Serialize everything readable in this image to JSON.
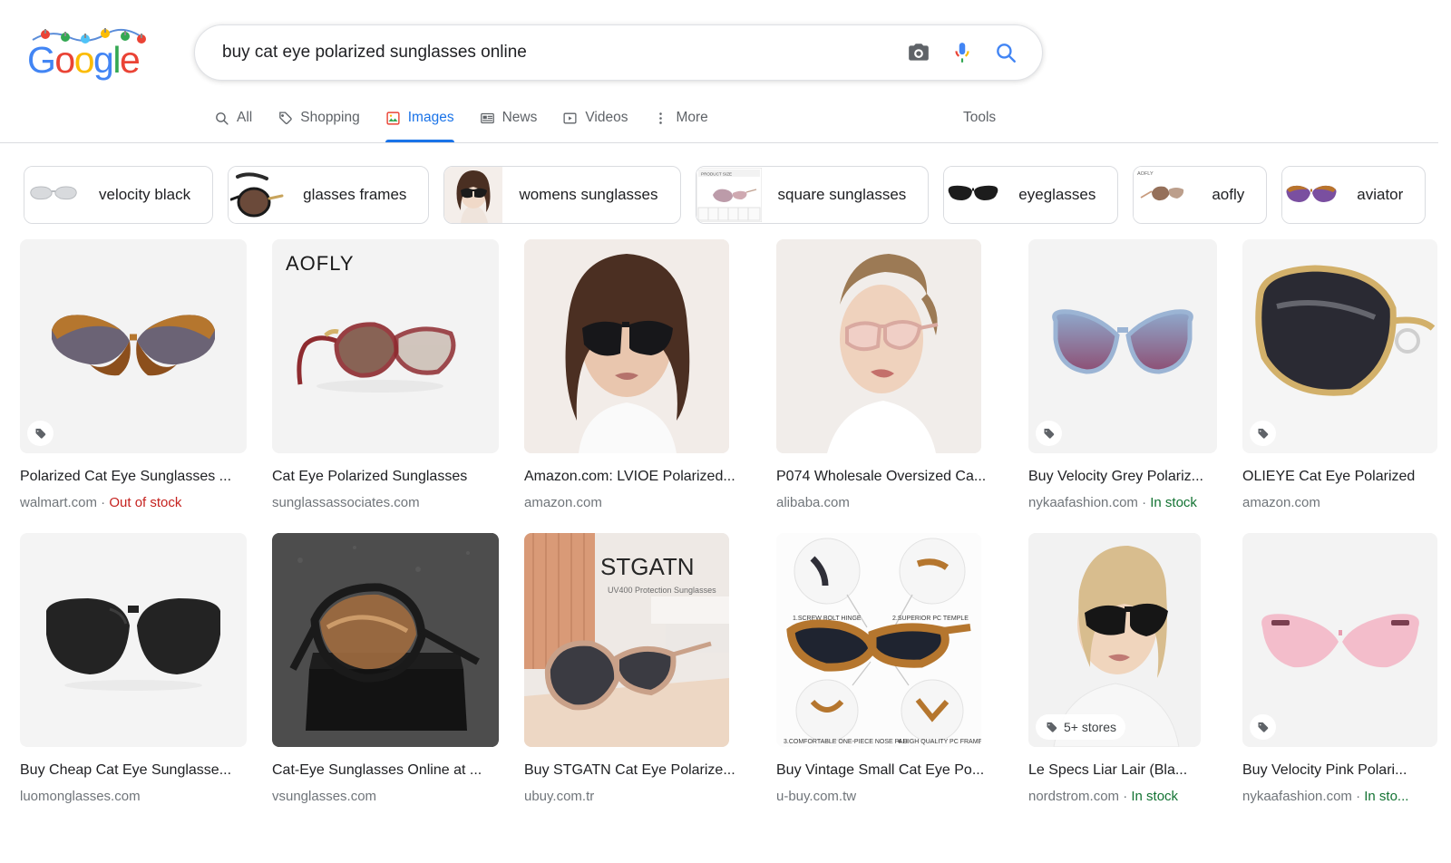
{
  "header": {
    "logo": {
      "letters": [
        {
          "ch": "G",
          "color": "#4285F4"
        },
        {
          "ch": "o",
          "color": "#EA4335"
        },
        {
          "ch": "o",
          "color": "#FBBC05"
        },
        {
          "ch": "g",
          "color": "#4285F4"
        },
        {
          "ch": "l",
          "color": "#34A853"
        },
        {
          "ch": "e",
          "color": "#EA4335"
        }
      ],
      "decoration": "holiday-string-lights"
    },
    "search": {
      "value": "buy cat eye polarized sunglasses online",
      "placeholder": "Search",
      "lens_icon": "camera-icon",
      "voice_icon": "microphone-icon",
      "submit_icon": "search-icon"
    },
    "tabs": [
      {
        "label": "All",
        "icon": "search-icon",
        "active": false
      },
      {
        "label": "Shopping",
        "icon": "tag-icon",
        "active": false
      },
      {
        "label": "Images",
        "icon": "image-icon",
        "active": true
      },
      {
        "label": "News",
        "icon": "newspaper-icon",
        "active": false
      },
      {
        "label": "Videos",
        "icon": "play-box-icon",
        "active": false
      },
      {
        "label": "More",
        "icon": "kebab-menu-icon",
        "active": false
      }
    ],
    "tools_label": "Tools"
  },
  "chips": [
    {
      "label": "velocity black",
      "thumb": "cat-eye-white-sunglasses"
    },
    {
      "label": "glasses frames",
      "thumb": "black-gold-round-frames"
    },
    {
      "label": "womens sunglasses",
      "thumb": "woman-wearing-cat-eye"
    },
    {
      "label": "square sunglasses",
      "thumb": "product-size-chart"
    },
    {
      "label": "eyeglasses",
      "thumb": "black-wayfarer"
    },
    {
      "label": "aofly",
      "thumb": "aofly-brown-sunglasses"
    },
    {
      "label": "aviator",
      "thumb": "tortoise-cat-eye"
    }
  ],
  "results": [
    {
      "title": "Polarized Cat Eye Sunglasses ...",
      "source": "walmart.com",
      "stock": "Out of stock",
      "stock_state": "out",
      "badge": "tag-icon",
      "badge_text": "",
      "image": "tortoise-cat-eye-sunglasses",
      "width": "full"
    },
    {
      "title": "Cat Eye Polarized Sunglasses",
      "source": "sunglassassociates.com",
      "stock": "",
      "stock_state": "none",
      "badge": "",
      "badge_text": "",
      "image": "aofly-red-sunglasses-pair",
      "width": "full"
    },
    {
      "title": "Amazon.com: LVIOE Polarized...",
      "source": "amazon.com",
      "stock": "",
      "stock_state": "none",
      "badge": "",
      "badge_text": "",
      "image": "woman-model-black-sunglasses",
      "width": "mid"
    },
    {
      "title": "P074 Wholesale Oversized Ca...",
      "source": "alibaba.com",
      "stock": "",
      "stock_state": "none",
      "badge": "",
      "badge_text": "",
      "image": "woman-model-rose-gold-sunglasses",
      "width": "mid"
    },
    {
      "title": "Buy Velocity Grey Polariz...",
      "source": "nykaafashion.com",
      "stock": "In stock",
      "stock_state": "in",
      "badge": "tag-icon",
      "badge_text": "",
      "image": "blue-gradient-cat-eye",
      "width": "narrow"
    },
    {
      "title": "OLIEYE Cat Eye Polarized",
      "source": "amazon.com",
      "stock": "",
      "stock_state": "none",
      "badge": "tag-icon",
      "badge_text": "",
      "image": "black-gold-oversized-sunglasses",
      "width": "narrow"
    },
    {
      "title": "Buy Cheap Cat Eye Sunglasse...",
      "source": "luomonglasses.com",
      "stock": "",
      "stock_state": "none",
      "badge": "",
      "badge_text": "",
      "image": "black-rounded-square-sunglasses",
      "width": "full"
    },
    {
      "title": "Cat-Eye Sunglasses Online at ...",
      "source": "vsunglasses.com",
      "stock": "",
      "stock_state": "none",
      "badge": "",
      "badge_text": "",
      "image": "brown-lens-sunglasses-on-case",
      "width": "full"
    },
    {
      "title": "Buy STGATN Cat Eye Polarize...",
      "source": "ubuy.com.tr",
      "stock": "",
      "stock_state": "none",
      "badge": "",
      "badge_text": "",
      "image": "stgatn-branded-sunglasses",
      "width": "mid"
    },
    {
      "title": "Buy Vintage Small Cat Eye Po...",
      "source": "u-buy.com.tw",
      "stock": "",
      "stock_state": "none",
      "badge": "",
      "badge_text": "",
      "image": "tortoise-sunglasses-feature-diagram",
      "width": "mid"
    },
    {
      "title": "Le Specs Liar Lair (Bla...",
      "source": "nordstrom.com",
      "stock": "In stock",
      "stock_state": "in",
      "badge": "tag-icon",
      "badge_text": "5+ stores",
      "image": "blonde-model-black-cat-eye",
      "width": "narrow"
    },
    {
      "title": "Buy Velocity Pink Polari...",
      "source": "nykaafashion.com",
      "stock": "In sto...",
      "stock_state": "in",
      "badge": "tag-icon",
      "badge_text": "",
      "image": "pink-rimless-cat-eye",
      "width": "narrow"
    }
  ]
}
